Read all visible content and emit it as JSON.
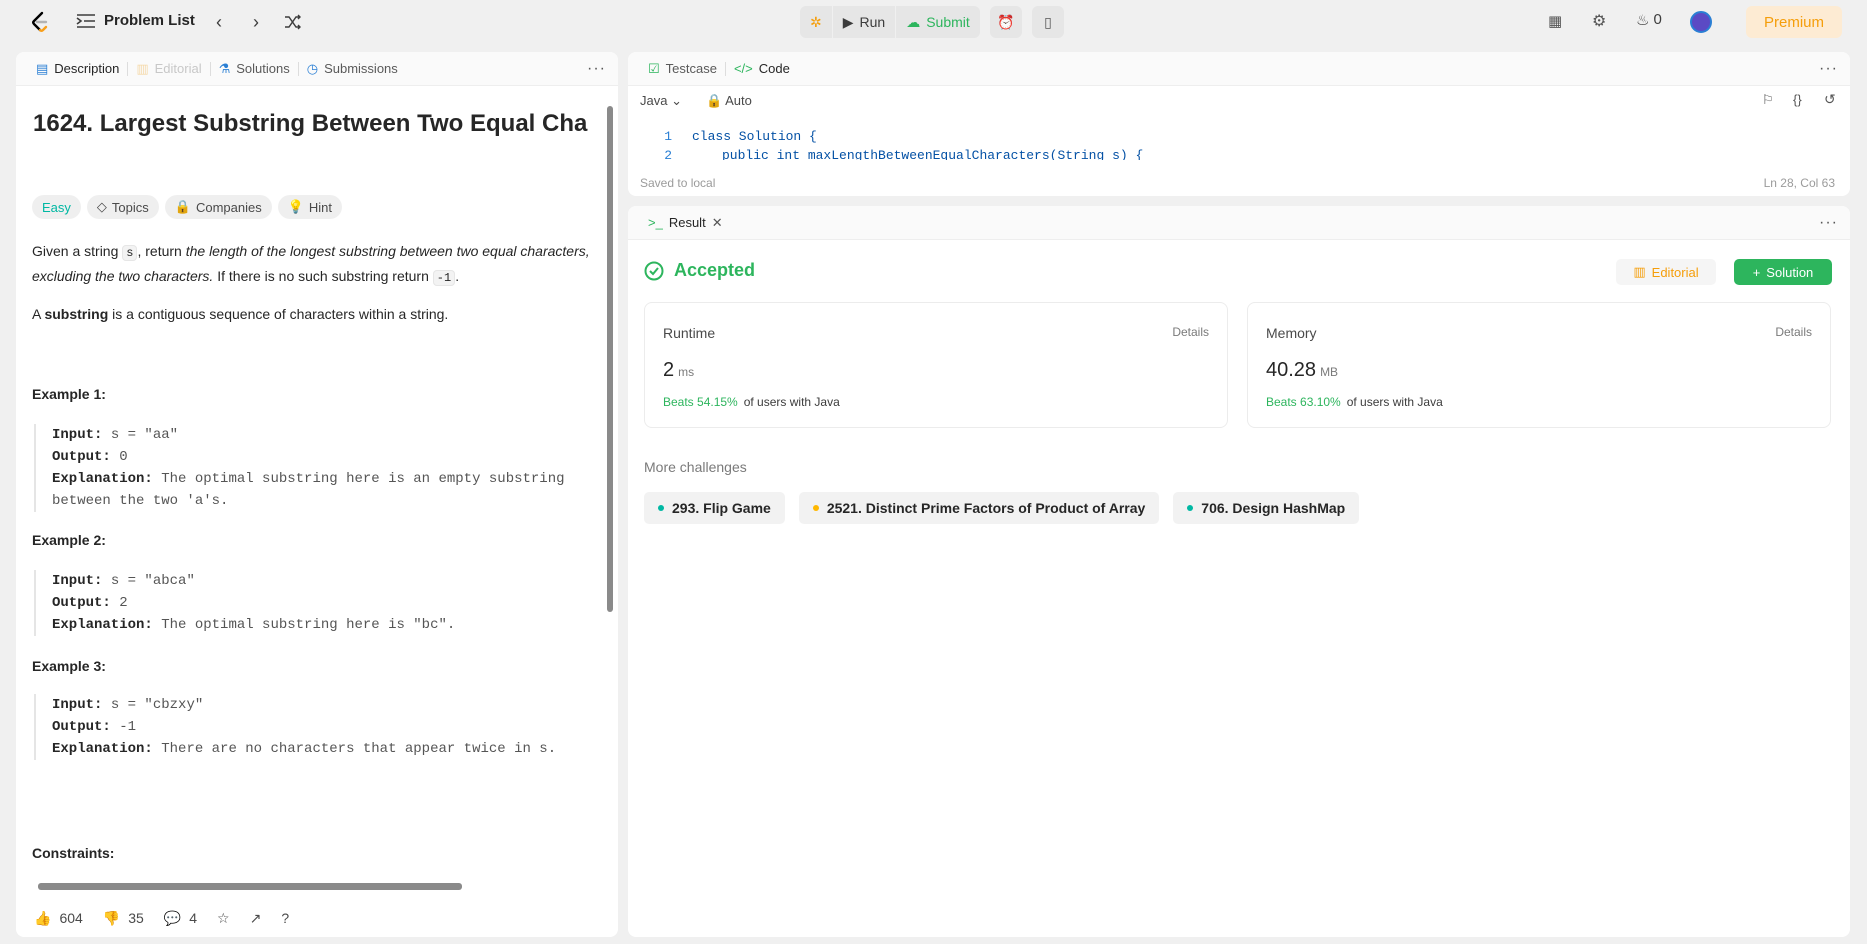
{
  "topbar": {
    "problem_list_label": "Problem List",
    "run_label": "Run",
    "submit_label": "Submit",
    "streak_count": "0",
    "premium_label": "Premium"
  },
  "left_tabs": {
    "description": "Description",
    "editorial": "Editorial",
    "solutions": "Solutions",
    "submissions": "Submissions"
  },
  "problem": {
    "title": "1624. Largest Substring Between Two Equal Cha",
    "difficulty": "Easy",
    "pills": [
      "Topics",
      "Companies",
      "Hint"
    ],
    "statement_prefix": "Given a string ",
    "statement_var": "s",
    "statement_mid": ", return ",
    "statement_em": "the length of the longest substring between two equal characters, excluding the two characters.",
    "statement_suffix": " If there is no such substring return ",
    "statement_neg": "-1",
    "statement_end": ".",
    "substring_def_a": "A ",
    "substring_def_b": "substring",
    "substring_def_c": " is a contiguous sequence of characters within a string.",
    "examples": [
      {
        "heading": "Example 1:",
        "input": "s = \"aa\"",
        "output": "0",
        "explanation": "The optimal substring here is an empty substring between the two 'a's."
      },
      {
        "heading": "Example 2:",
        "input": "s = \"abca\"",
        "output": "2",
        "explanation": "The optimal substring here is \"bc\"."
      },
      {
        "heading": "Example 3:",
        "input": "s = \"cbzxy\"",
        "output": "-1",
        "explanation": "There are no characters that appear twice in s."
      }
    ],
    "input_label": "Input:",
    "output_label": "Output:",
    "explanation_label": "Explanation:",
    "constraints_label": "Constraints:"
  },
  "footer": {
    "likes": "604",
    "dislikes": "35",
    "comments": "4"
  },
  "code_panel": {
    "tab_testcase": "Testcase",
    "tab_code": "Code",
    "language": "Java",
    "mode": "Auto",
    "line1_num": "1",
    "line1": "class Solution {",
    "line2_num": "2",
    "line2": "public int maxLengthBetweenEqualCharacters(String s) {",
    "saved": "Saved to local",
    "cursor": "Ln 28, Col 63"
  },
  "result": {
    "tab": "Result",
    "status": "Accepted",
    "editorial_btn": "Editorial",
    "solution_btn": "Solution",
    "runtime": {
      "title": "Runtime",
      "details": "Details",
      "value": "2",
      "unit": "ms",
      "beats": "Beats 54.15%",
      "suffix": "of users with Java"
    },
    "memory": {
      "title": "Memory",
      "details": "Details",
      "value": "40.28",
      "unit": "MB",
      "beats": "Beats 63.10%",
      "suffix": "of users with Java"
    },
    "more_challenges": "More challenges",
    "challenges": [
      {
        "label": "293. Flip Game",
        "color": "#00b8a3"
      },
      {
        "label": "2521. Distinct Prime Factors of Product of Array",
        "color": "#ffb800"
      },
      {
        "label": "706. Design HashMap",
        "color": "#00b8a3"
      }
    ]
  }
}
